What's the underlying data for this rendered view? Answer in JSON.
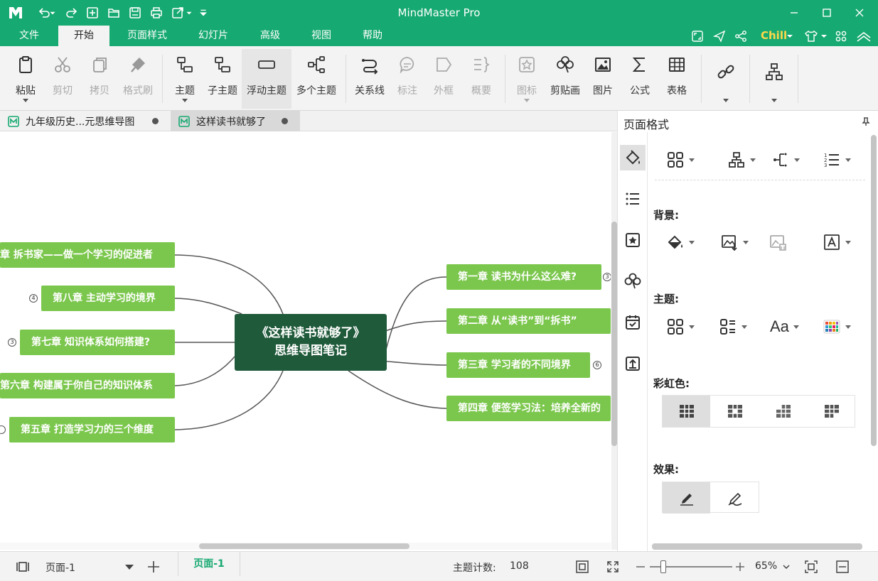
{
  "app": {
    "title": "MindMaster Pro",
    "accent_color": "#16a971",
    "logo": "mindmaster-logo-icon"
  },
  "quick_access": [
    {
      "icon": "undo-icon"
    },
    {
      "icon": "redo-icon"
    },
    {
      "icon": "new-file-icon"
    },
    {
      "icon": "open-folder-icon"
    },
    {
      "icon": "save-icon"
    },
    {
      "icon": "print-icon"
    },
    {
      "icon": "export-icon"
    },
    {
      "icon": "customize-icon"
    }
  ],
  "menu": {
    "items": [
      "文件",
      "开始",
      "页面样式",
      "幻灯片",
      "高级",
      "视图",
      "帮助"
    ],
    "active": "开始",
    "user": "Chill"
  },
  "ribbon": {
    "paste": "粘贴",
    "cut": "剪切",
    "copy": "拷贝",
    "format_painter": "格式刷",
    "topic": "主题",
    "subtopic": "子主题",
    "floating_topic": "浮动主题",
    "multiple_topics": "多个主题",
    "relationship": "关系线",
    "callout": "标注",
    "boundary": "外框",
    "summary": "概要",
    "icon": "图标",
    "clipart": "剪贴画",
    "picture": "图片",
    "formula": "公式",
    "table": "表格"
  },
  "doc_tabs": [
    {
      "label": "九年级历史...元思维导图"
    },
    {
      "label": "这样读书就够了"
    }
  ],
  "mindmap": {
    "central_line1": "《这样读书就够了》",
    "central_line2": "思维导图笔记",
    "central_color": "#1f5a3a",
    "topic_color": "#7bc74d",
    "right_topics": [
      {
        "label": "第一章 读书为什么这么难?",
        "badge": "3"
      },
      {
        "label": "第二章 从“读书”到“拆书”"
      },
      {
        "label": "第三章 学习者的不同境界",
        "badge": "6"
      },
      {
        "label": "第四章 便签学习法：培养全新的"
      }
    ],
    "left_topics": [
      {
        "label": "章 拆书家——做一个学习的促进者"
      },
      {
        "label": "第八章 主动学习的境界",
        "badge": "4"
      },
      {
        "label": "第七章 知识体系如何搭建?",
        "badge": "3"
      },
      {
        "label": "第六章 构建属于你自己的知识体系"
      },
      {
        "label": "第五章 打造学习力的三个维度"
      }
    ]
  },
  "panel": {
    "title": "页面格式",
    "background_label": "背景:",
    "theme_label": "主题:",
    "rainbow_label": "彩虹色:",
    "effect_label": "效果:",
    "theme_font": "Aa"
  },
  "status": {
    "page_select": "页面-1",
    "page_tab": "页面-1",
    "topic_count_label": "主题计数:",
    "topic_count": "108",
    "zoom": "65%"
  }
}
